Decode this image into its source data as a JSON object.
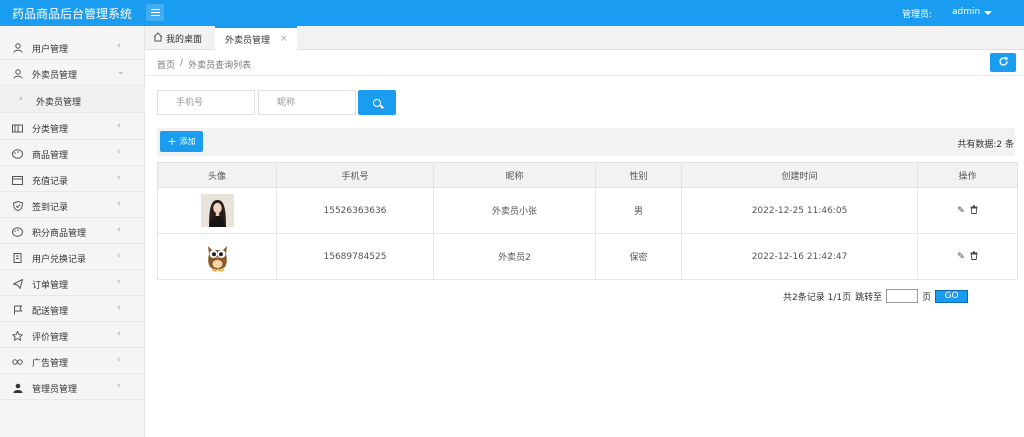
{
  "app": {
    "title": "药品商品后台管理系统"
  },
  "topbar": {
    "admin_label": "管理员:",
    "admin_user": "admin"
  },
  "sidebar": {
    "items": [
      {
        "label": "用户管理",
        "icon": "user-icon"
      },
      {
        "label": "外卖员管理",
        "icon": "user-icon"
      },
      {
        "label": "外卖员管理",
        "icon": "chevron-right-icon"
      },
      {
        "label": "分类管理",
        "icon": "category-icon"
      },
      {
        "label": "商品管理",
        "icon": "palette-icon"
      },
      {
        "label": "充值记录",
        "icon": "calendar-icon"
      },
      {
        "label": "签到记录",
        "icon": "shield-check-icon"
      },
      {
        "label": "积分商品管理",
        "icon": "palette-icon"
      },
      {
        "label": "用户兑换记录",
        "icon": "document-icon"
      },
      {
        "label": "订单管理",
        "icon": "paper-plane-icon"
      },
      {
        "label": "配送管理",
        "icon": "flag-icon"
      },
      {
        "label": "评价管理",
        "icon": "star-icon"
      },
      {
        "label": "广告管理",
        "icon": "link-icon"
      },
      {
        "label": "管理员管理",
        "icon": "person-icon"
      }
    ]
  },
  "tabs": {
    "home": "我的桌面",
    "active": "外卖员管理",
    "close": "×"
  },
  "breadcrumb": {
    "home": "首页",
    "separator": "/",
    "current": "外卖员查询列表"
  },
  "search": {
    "phone_placeholder": "手机号",
    "nickname_placeholder": "昵称"
  },
  "toolbar": {
    "add_label": "添加",
    "total_text": "共有数据:2 条"
  },
  "table": {
    "headers": {
      "avatar": "头像",
      "phone": "手机号",
      "nickname": "昵称",
      "gender": "性别",
      "created": "创建时间",
      "actions": "操作"
    },
    "rows": [
      {
        "phone": "15526363636",
        "nickname": "外卖员小张",
        "gender": "男",
        "created": "2022-12-25 11:46:05"
      },
      {
        "phone": "15689784525",
        "nickname": "外卖员2",
        "gender": "保密",
        "created": "2022-12-16 21:42:47"
      }
    ]
  },
  "pager": {
    "summary": "共2条记录 1/1页",
    "jump_label": "跳转至",
    "page_unit": "页",
    "go_label": "GO"
  },
  "colors": {
    "primary": "#1a9cf0"
  }
}
